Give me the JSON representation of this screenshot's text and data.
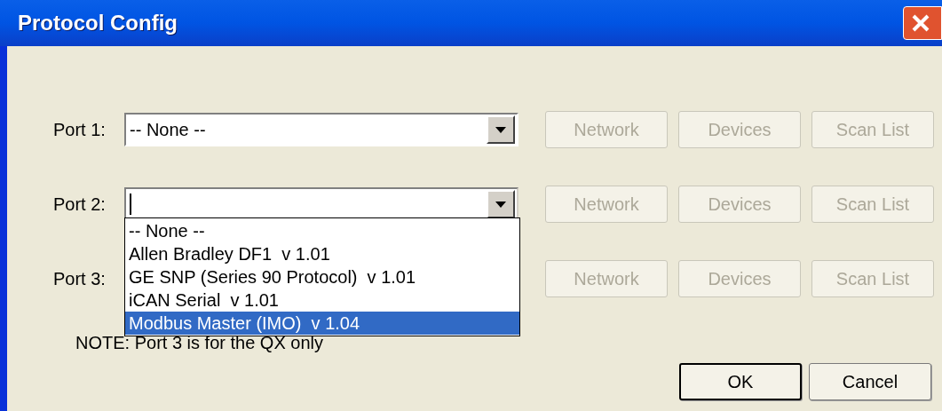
{
  "window": {
    "title": "Protocol Config"
  },
  "ports": [
    {
      "label": "Port 1:",
      "value": "-- None --",
      "focused": false,
      "buttons": [
        {
          "label": "Network",
          "disabled": true
        },
        {
          "label": "Devices",
          "disabled": true
        },
        {
          "label": "Scan List",
          "disabled": true
        }
      ]
    },
    {
      "label": "Port 2:",
      "focused": true,
      "buttons": [
        {
          "label": "Network",
          "disabled": true
        },
        {
          "label": "Devices",
          "disabled": true
        },
        {
          "label": "Scan List",
          "disabled": true
        }
      ]
    },
    {
      "label": "Port 3:",
      "buttons": [
        {
          "label": "Network",
          "disabled": true
        },
        {
          "label": "Devices",
          "disabled": true
        },
        {
          "label": "Scan List",
          "disabled": true
        }
      ]
    }
  ],
  "dropdown": {
    "options": [
      {
        "label": "-- None --",
        "selected": false
      },
      {
        "label": "Allen Bradley DF1  v 1.01",
        "selected": false
      },
      {
        "label": "GE SNP (Series 90 Protocol)  v 1.01",
        "selected": false
      },
      {
        "label": "iCAN Serial  v 1.01",
        "selected": false
      },
      {
        "label": "Modbus Master (IMO)  v 1.04",
        "selected": true
      }
    ]
  },
  "note": "NOTE: Port 3 is for the QX only",
  "buttons": [
    {
      "label": "OK",
      "default": true
    },
    {
      "label": "Cancel",
      "default": false
    }
  ]
}
